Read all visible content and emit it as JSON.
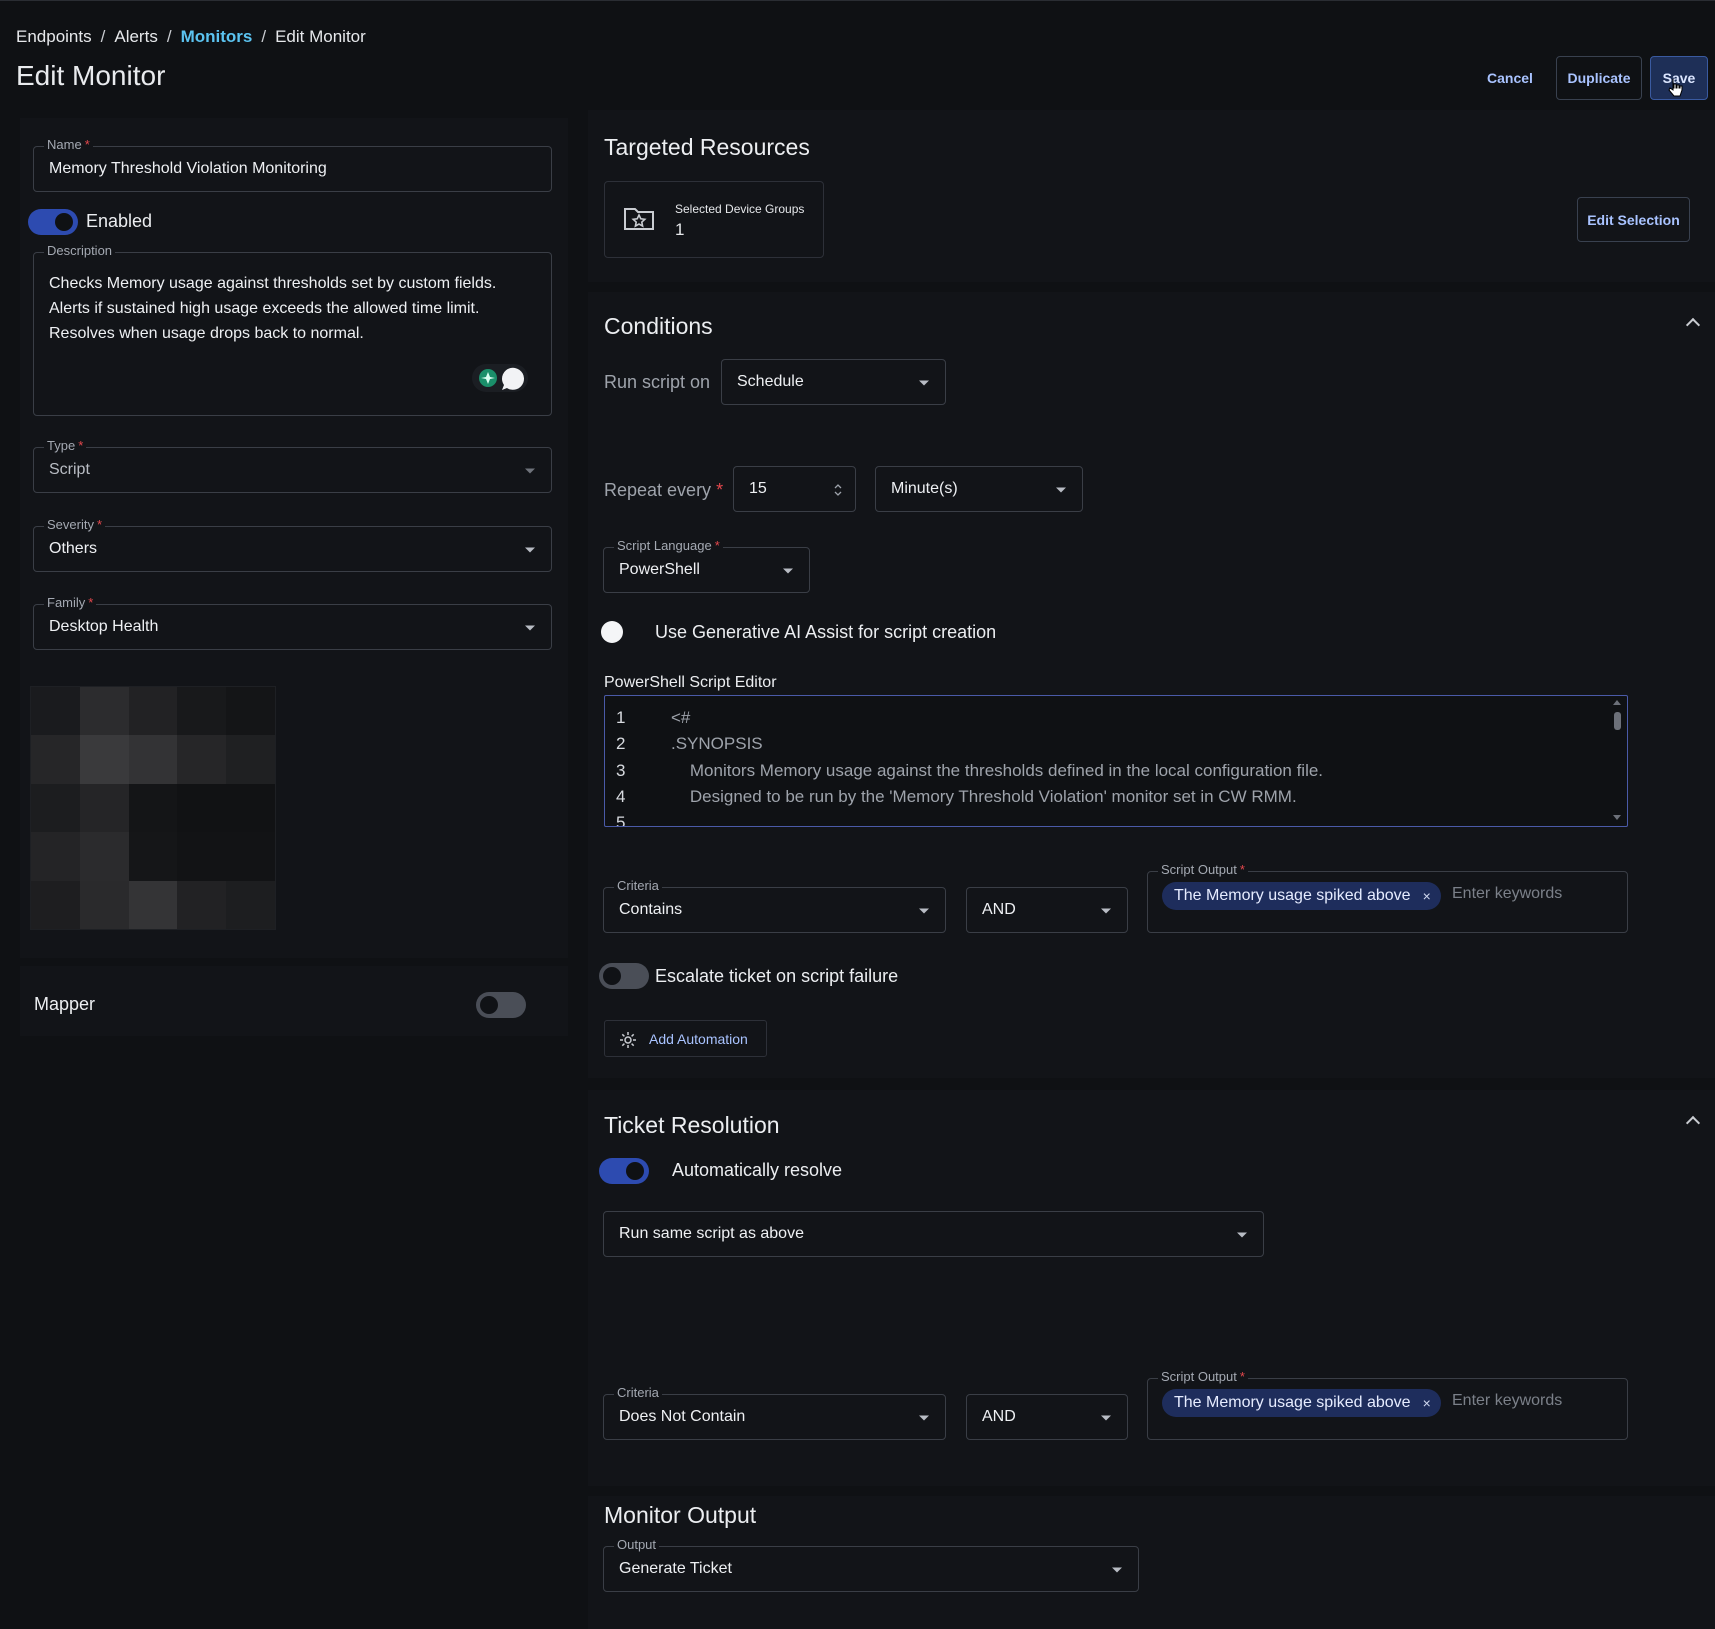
{
  "breadcrumb": {
    "items": [
      "Endpoints",
      "Alerts",
      "Monitors",
      "Edit Monitor"
    ],
    "separator": "/"
  },
  "page_title": "Edit Monitor",
  "header_buttons": {
    "cancel": "Cancel",
    "duplicate": "Duplicate",
    "save": "Save"
  },
  "left": {
    "name": {
      "label": "Name",
      "required": "*",
      "value": "Memory Threshold Violation Monitoring"
    },
    "enabled": {
      "label": "Enabled",
      "on": true
    },
    "description": {
      "label": "Description",
      "lines": [
        "Checks Memory usage against thresholds set by custom fields.",
        "Alerts if sustained high usage exceeds the allowed time limit.",
        "Resolves when usage drops back to normal."
      ]
    },
    "type": {
      "label": "Type",
      "required": "*",
      "value": "Script"
    },
    "severity": {
      "label": "Severity",
      "required": "*",
      "value": "Others"
    },
    "family": {
      "label": "Family",
      "required": "*",
      "value": "Desktop Health"
    },
    "mapper": {
      "label": "Mapper",
      "on": false
    }
  },
  "targeted": {
    "title": "Targeted Resources",
    "card_label": "Selected Device Groups",
    "card_value": "1",
    "edit_button": "Edit Selection"
  },
  "conditions": {
    "title": "Conditions",
    "run_label": "Run script on",
    "run_value": "Schedule",
    "repeat_label": "Repeat every",
    "required": "*",
    "repeat_value": "15",
    "repeat_unit": "Minute(s)",
    "language": {
      "label": "Script Language",
      "required": "*",
      "value": "PowerShell"
    },
    "ai_assist": "Use Generative AI Assist for script creation",
    "editor_label": "PowerShell Script Editor",
    "code": [
      {
        "n": "1",
        "t": "<#"
      },
      {
        "n": "2",
        "t": ".SYNOPSIS"
      },
      {
        "n": "3",
        "t": "    Monitors Memory usage against the thresholds defined in the local configuration file."
      },
      {
        "n": "4",
        "t": "    Designed to be run by the 'Memory Threshold Violation' monitor set in CW RMM."
      },
      {
        "n": "5",
        "t": ""
      }
    ],
    "criteria": {
      "label": "Criteria",
      "value": "Contains"
    },
    "operator": "AND",
    "script_output": {
      "label": "Script Output",
      "required": "*",
      "chip": "The Memory usage spiked above",
      "chip_remove": "×",
      "placeholder": "Enter keywords"
    },
    "escalate": {
      "label": "Escalate ticket on script failure",
      "on": false
    },
    "add_automation": "Add Automation"
  },
  "resolution": {
    "title": "Ticket Resolution",
    "auto_resolve": {
      "label": "Automatically resolve",
      "on": true
    },
    "script_select": "Run same script as above",
    "criteria": {
      "label": "Criteria",
      "value": "Does Not Contain"
    },
    "operator": "AND",
    "script_output": {
      "label": "Script Output",
      "required": "*",
      "chip": "The Memory usage spiked above",
      "chip_remove": "×",
      "placeholder": "Enter keywords"
    }
  },
  "monitor_output": {
    "title": "Monitor Output",
    "label": "Output",
    "value": "Generate Ticket"
  },
  "colors": {
    "accent": "#5bc3f0",
    "primary": "#2d4bb0",
    "chip": "#1e2d5c",
    "required": "#e5484d"
  }
}
